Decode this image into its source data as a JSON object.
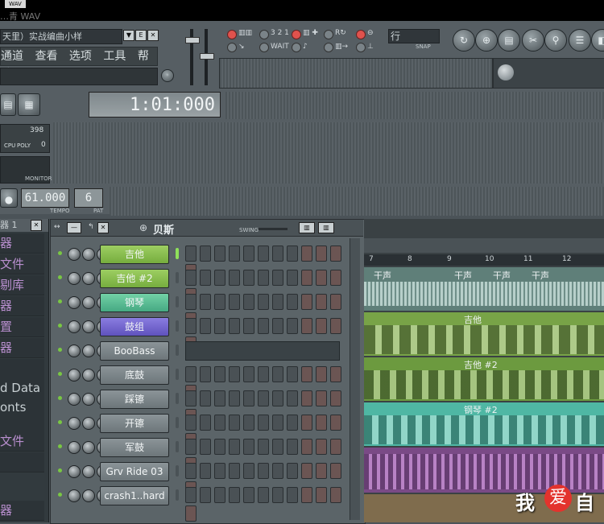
{
  "window": {
    "badge": "WAV",
    "title": "…青 WAV"
  },
  "song": {
    "name": "天里）实战编曲小样"
  },
  "menu": {
    "items": [
      "通道",
      "查看",
      "选项",
      "工具",
      "帮助"
    ]
  },
  "transport": {
    "time": "1:01:000",
    "tempo": "61.000",
    "tempo_label": "TEMPO",
    "pattern": "6",
    "pattern_label": "PAT",
    "cpu_value": "398",
    "poly_value": "0",
    "cpu_label": "CPU",
    "poly_label": "POLY",
    "monitor_label": "MONITOR",
    "snap_label": "SNAP",
    "mode_value": "行",
    "step_labels": [
      "3 2 1",
      "WAIT",
      "REC"
    ]
  },
  "browser": {
    "header": "器 1",
    "items": [
      "器",
      "文件",
      "剔库",
      "器",
      "置",
      "器",
      "",
      "d Data",
      "onts",
      "",
      "文件",
      "",
      "器"
    ]
  },
  "rack": {
    "pattern_name": "贝斯",
    "swing_label": "SWING",
    "channels": [
      {
        "name": "吉他",
        "color": "green",
        "selected": true
      },
      {
        "name": "吉他 #2",
        "color": "green",
        "selected": false
      },
      {
        "name": "钢琴",
        "color": "teal",
        "selected": false
      },
      {
        "name": "鼓组",
        "color": "purple",
        "selected": false
      },
      {
        "name": "BooBass",
        "color": "gray",
        "selected": false,
        "piano_roll": true
      },
      {
        "name": "底鼓",
        "color": "gray",
        "selected": false
      },
      {
        "name": "踩镲",
        "color": "gray",
        "selected": false
      },
      {
        "name": "开镲",
        "color": "gray",
        "selected": false
      },
      {
        "name": "军鼓",
        "color": "gray",
        "selected": false
      },
      {
        "name": "Grv Ride 03",
        "color": "gray",
        "selected": false
      },
      {
        "name": "crash1..hard",
        "color": "gray",
        "selected": false
      }
    ]
  },
  "playlist": {
    "ruler": [
      "7",
      "8",
      "9",
      "10",
      "11",
      "12"
    ],
    "audio_clips": [
      "干声",
      "干声",
      "干声",
      "干声"
    ],
    "pattern_clips": [
      "吉他",
      "吉他 #2",
      "钢琴 #2"
    ]
  },
  "watermark": {
    "text": "我",
    "heart": "爱",
    "after": "自"
  }
}
